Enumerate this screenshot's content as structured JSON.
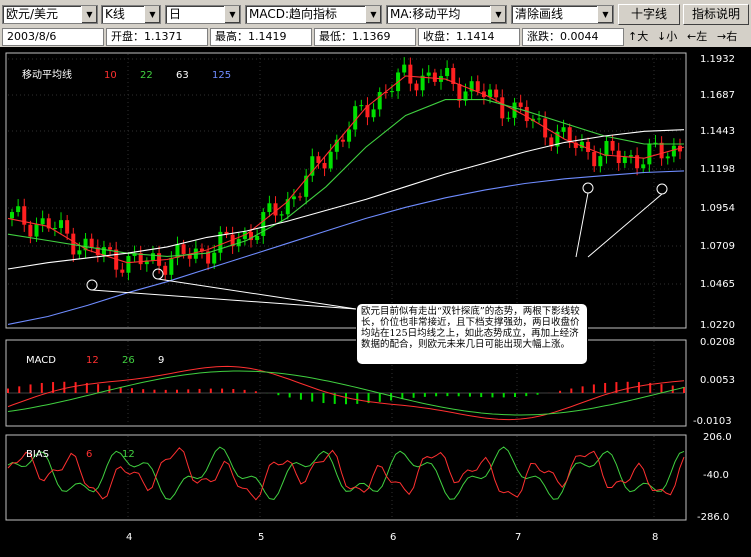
{
  "toolbar": {
    "pair": "欧元/美元",
    "chart_kind": "K线",
    "period": "日",
    "indicator": "MACD:趋向指标",
    "ma": "MA:移动平均",
    "clear": "清除画线",
    "crosshair_button": "十字线",
    "help_button": "指标说明"
  },
  "quote": {
    "date": "2003/8/6",
    "open": "开盘：1.1371",
    "high": "最高：1.1419",
    "low": "最低：1.1369",
    "close": "收盘：1.1414",
    "change": "涨跌：0.0044"
  },
  "nav": {
    "zoom_in": "↑大",
    "zoom_out": "↓小",
    "left": "←左",
    "right": "→右"
  },
  "main_panel": {
    "title": "移动平均线",
    "ma_periods": [
      "10",
      "22",
      "63",
      "125"
    ],
    "y_ticks": [
      "1.1932",
      "1.1687",
      "1.1443",
      "1.1198",
      "1.0954",
      "1.0709",
      "1.0465",
      "1.0220"
    ],
    "annotation": "欧元目前似有走出“双针探底”的态势，两根下影线较长，价位也非常接近，且下档支撑强劲，两日收盘价均站在125日均线之上，如此态势成立，再加上经济数据的配合，则欧元未来几日可能出现大幅上涨。"
  },
  "macd_panel": {
    "title": "MACD",
    "params": [
      "12",
      "26",
      "9"
    ],
    "y_ticks": [
      "0.0208",
      "0.0053",
      "-0.0103"
    ]
  },
  "bias_panel": {
    "title": "BIAS",
    "params": [
      "6",
      "12"
    ],
    "y_ticks": [
      "206.0",
      "-40.0",
      "-286.0"
    ]
  },
  "x_axis": [
    "4",
    "5",
    "6",
    "7",
    "8"
  ],
  "colors": {
    "ma10": "#ff3030",
    "ma22": "#40d040",
    "ma63": "#ffffff",
    "ma125": "#6f8cff",
    "up": "#00e000",
    "down": "#ff2020",
    "macd_dif": "#ff3030",
    "macd_dea": "#40d040"
  },
  "chart_data": {
    "type": "line",
    "x_ticks": [
      "4",
      "5",
      "6",
      "7",
      "8"
    ],
    "ylim": [
      1.022,
      1.1932
    ],
    "series": [
      {
        "name": "10",
        "values": [
          1.09,
          1.085,
          1.07,
          1.062,
          1.064,
          1.07,
          1.08,
          1.1,
          1.13,
          1.16,
          1.18,
          1.178,
          1.168,
          1.155,
          1.14,
          1.13,
          1.128,
          1.135
        ]
      },
      {
        "name": "22",
        "values": [
          1.08,
          1.076,
          1.072,
          1.068,
          1.066,
          1.068,
          1.076,
          1.09,
          1.11,
          1.135,
          1.155,
          1.165,
          1.165,
          1.158,
          1.15,
          1.142,
          1.137,
          1.137
        ]
      },
      {
        "name": "63",
        "values": [
          1.058,
          1.062,
          1.065,
          1.068,
          1.072,
          1.078,
          1.082,
          1.088,
          1.095,
          1.102,
          1.11,
          1.118,
          1.125,
          1.132,
          1.138,
          1.142,
          1.145,
          1.146
        ]
      },
      {
        "name": "125",
        "values": [
          1.023,
          1.028,
          1.035,
          1.043,
          1.05,
          1.058,
          1.066,
          1.074,
          1.082,
          1.09,
          1.097,
          1.103,
          1.108,
          1.112,
          1.115,
          1.117,
          1.119,
          1.12
        ]
      }
    ]
  }
}
